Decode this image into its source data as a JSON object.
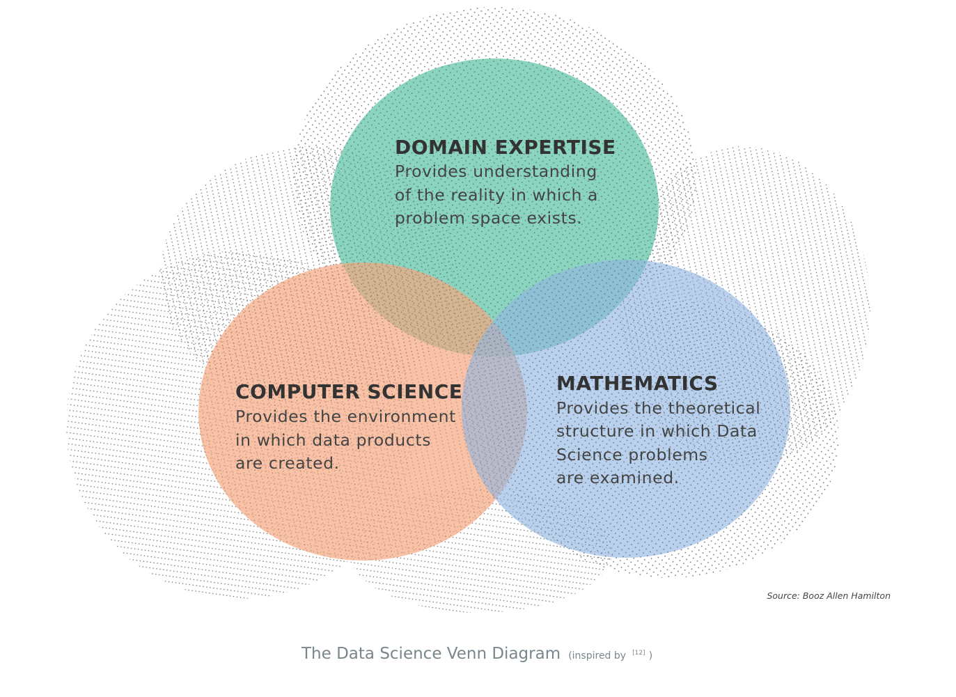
{
  "colors": {
    "domain": "#5ec4a6",
    "computer": "#f6a57c",
    "math": "#8fb4e2",
    "dots": "#555555",
    "heading": "#333333",
    "body": "#444444",
    "caption": "#79868c"
  },
  "circles": {
    "domain": {
      "title": "DOMAIN EXPERTISE",
      "lines": [
        "Provides understanding",
        "of the reality in which a",
        "problem space exists."
      ]
    },
    "computer": {
      "title": "COMPUTER SCIENCE",
      "lines": [
        "Provides the environment",
        "in which data products",
        "are created."
      ]
    },
    "math": {
      "title": "MATHEMATICS",
      "lines": [
        "Provides the theoretical",
        "structure in which Data",
        "Science problems",
        "are examined."
      ]
    }
  },
  "source": "Source: Booz Allen Hamilton",
  "caption": {
    "main": "The Data Science Venn Diagram",
    "note_prefix": "(inspired by",
    "note_ref": "[12]",
    "note_suffix": ")"
  }
}
